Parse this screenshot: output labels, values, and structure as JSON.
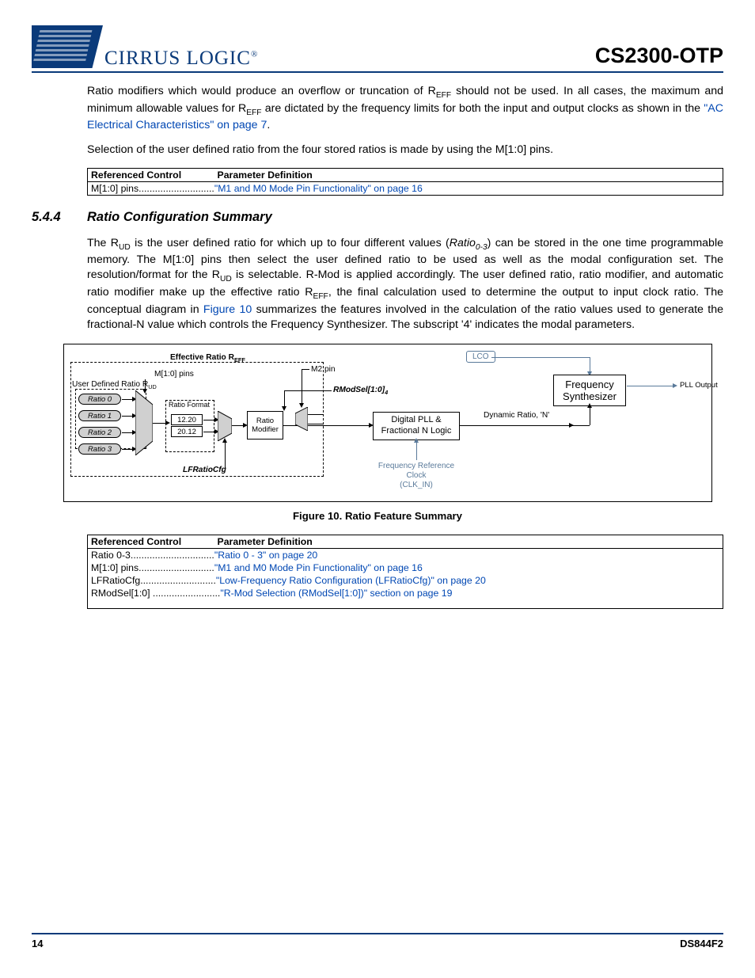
{
  "header": {
    "logo_text": "CIRRUS LOGIC",
    "doc_title": "CS2300-OTP"
  },
  "para1_a": "Ratio modifiers which would produce an overflow or truncation of R",
  "para1_sub1": "EFF",
  "para1_b": " should not be used. In all cases, the maximum and minimum allowable values for R",
  "para1_sub2": "EFF",
  "para1_c": " are dictated by the frequency limits for both the input and output clocks as shown in the ",
  "para1_link": "\"AC Electrical Characteristics\" on page 7",
  "para1_d": ".",
  "para2": "Selection of the user defined ratio from the four stored ratios is made by using the M[1:0] pins.",
  "table1": {
    "h1": "Referenced Control",
    "h2": "Parameter Definition",
    "rows": [
      {
        "ctrl": "M[1:0] pins",
        "dots": "............................",
        "def": "\"M1 and M0 Mode Pin Functionality\" on page 16"
      }
    ]
  },
  "section": {
    "num": "5.4.4",
    "title": "Ratio Configuration Summary"
  },
  "para3_a": "The R",
  "para3_sub1": "UD",
  "para3_b": " is the user defined ratio for which up to four different values (",
  "para3_i": "Ratio",
  "para3_isub": "0-3",
  "para3_c": ") can be stored in the one time programmable memory. The M[1:0] pins then select the user defined ratio to be used as well as the modal configuration set. The resolution/format for the R",
  "para3_sub2": "UD",
  "para3_d": " is selectable. R-Mod is applied accordingly. The user defined ratio, ratio modifier, and automatic ratio modifier make up the effective ratio R",
  "para3_sub3": "EFF",
  "para3_e": ", the final calculation used to determine the output to input clock ratio. The conceptual diagram in ",
  "para3_link": "Figure 10",
  "para3_f": " summarizes the features involved in the calculation of the ratio values used to generate the fractional-N value which controls the Frequency Synthesizer. The subscript '4' indicates the modal parameters.",
  "diagram": {
    "eff_ratio": "Effective Ratio R",
    "eff_sub": "EFF",
    "user_ratio": "User Defined Ratio R",
    "user_sub": "UD",
    "m10": "M[1:0] pins",
    "m2": "M2 pin",
    "ratio": [
      "Ratio 0",
      "Ratio 1",
      "Ratio 2",
      "Ratio 3"
    ],
    "format": "Ratio Format",
    "v1": "12.20",
    "v2": "20.12",
    "rmod": "Ratio Modifier",
    "rmodsel": "RModSel[1:0]",
    "rmodsel_sub": "4",
    "lfratio": "LFRatioCfg",
    "dpll": "Digital PLL & Fractional N Logic",
    "dyn": "Dynamic Ratio, 'N'",
    "lco": "LCO",
    "freq": "Frequency Synthesizer",
    "pllout": "PLL Output",
    "refclk1": "Frequency Reference Clock",
    "refclk2": "(CLK_IN)"
  },
  "fig_caption": "Figure 10.  Ratio Feature Summary",
  "table2": {
    "h1": "Referenced Control",
    "h2": "Parameter Definition",
    "rows": [
      {
        "ctrl": "Ratio 0-3",
        "dots": "...............................",
        "def": "\"Ratio 0 - 3\" on page 20"
      },
      {
        "ctrl": "M[1:0] pins",
        "dots": "............................",
        "def": "\"M1 and M0 Mode Pin Functionality\" on page 16"
      },
      {
        "ctrl": "LFRatioCfg",
        "dots": "............................",
        "def": "\"Low-Frequency Ratio Configuration (LFRatioCfg)\" on page 20"
      },
      {
        "ctrl": "RModSel[1:0]",
        "dots": " .........................",
        "def": "\"R-Mod Selection (RModSel[1:0])\" section on page 19"
      }
    ]
  },
  "footer": {
    "page": "14",
    "docid": "DS844F2"
  }
}
